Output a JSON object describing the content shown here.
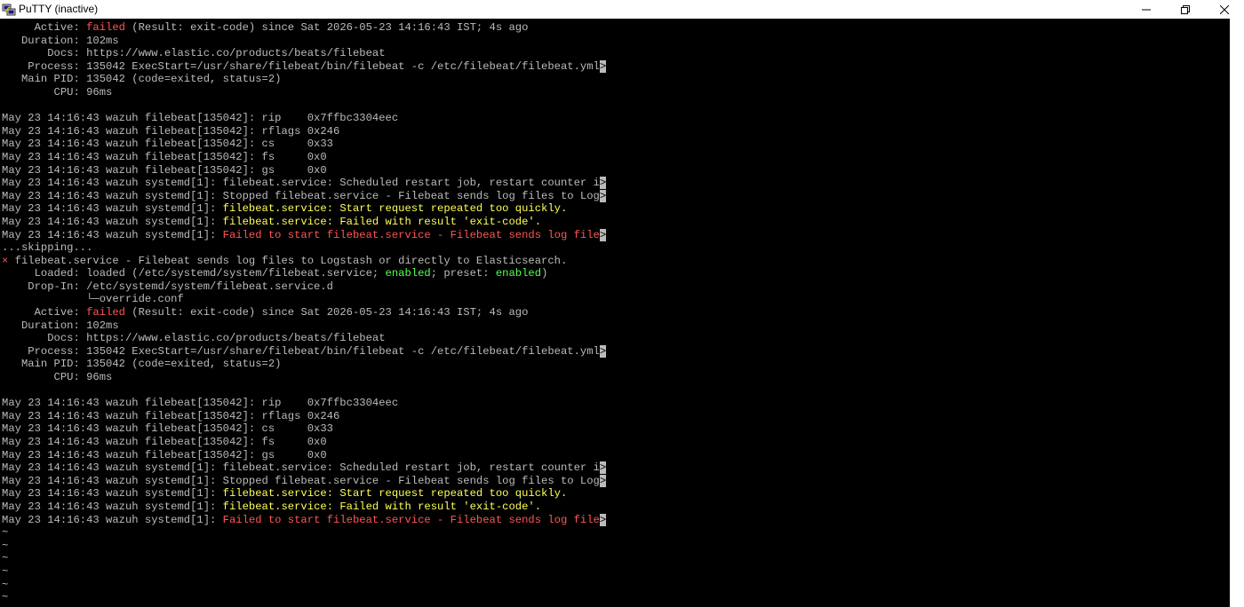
{
  "window": {
    "title": "PuTTY (inactive)",
    "icon": "putty-icon",
    "controls": [
      "minimize-icon",
      "restore-icon",
      "close-icon"
    ]
  },
  "terminal": {
    "lines": [
      {
        "segments": [
          {
            "t": "     Active: "
          },
          {
            "t": "failed",
            "c": "red"
          },
          {
            "t": " (Result: exit-code) since Sat 2026-05-23 14:16:43 IST; 4s ago"
          }
        ]
      },
      {
        "segments": [
          {
            "t": "   Duration: 102ms"
          }
        ]
      },
      {
        "segments": [
          {
            "t": "       Docs: https://www.elastic.co/products/beats/filebeat"
          }
        ]
      },
      {
        "segments": [
          {
            "t": "    Process: 135042 ExecStart=/usr/share/filebeat/bin/filebeat -c /etc/filebeat/filebeat.yml"
          },
          {
            "t": ">",
            "c": "trunc"
          }
        ]
      },
      {
        "segments": [
          {
            "t": "   Main PID: 135042 (code=exited, status=2)"
          }
        ]
      },
      {
        "segments": [
          {
            "t": "        CPU: 96ms"
          }
        ]
      },
      {
        "segments": [
          {
            "t": ""
          }
        ]
      },
      {
        "segments": [
          {
            "t": "May 23 14:16:43 wazuh filebeat[135042]: rip    0x7ffbc3304eec"
          }
        ]
      },
      {
        "segments": [
          {
            "t": "May 23 14:16:43 wazuh filebeat[135042]: rflags 0x246"
          }
        ]
      },
      {
        "segments": [
          {
            "t": "May 23 14:16:43 wazuh filebeat[135042]: cs     0x33"
          }
        ]
      },
      {
        "segments": [
          {
            "t": "May 23 14:16:43 wazuh filebeat[135042]: fs     0x0"
          }
        ]
      },
      {
        "segments": [
          {
            "t": "May 23 14:16:43 wazuh filebeat[135042]: gs     0x0"
          }
        ]
      },
      {
        "segments": [
          {
            "t": "May 23 14:16:43 wazuh systemd[1]: filebeat.service: Scheduled restart job, restart counter i"
          },
          {
            "t": ">",
            "c": "trunc"
          }
        ]
      },
      {
        "segments": [
          {
            "t": "May 23 14:16:43 wazuh systemd[1]: Stopped filebeat.service - Filebeat sends log files to Log"
          },
          {
            "t": ">",
            "c": "trunc"
          }
        ]
      },
      {
        "segments": [
          {
            "t": "May 23 14:16:43 wazuh systemd[1]: "
          },
          {
            "t": "filebeat.service: Start request repeated too quickly.",
            "c": "yellow"
          }
        ]
      },
      {
        "segments": [
          {
            "t": "May 23 14:16:43 wazuh systemd[1]: "
          },
          {
            "t": "filebeat.service: Failed with result 'exit-code'.",
            "c": "yellow"
          }
        ]
      },
      {
        "segments": [
          {
            "t": "May 23 14:16:43 wazuh systemd[1]: "
          },
          {
            "t": "Failed to start filebeat.service - Filebeat sends log file",
            "c": "red"
          },
          {
            "t": ">",
            "c": "trunc"
          }
        ]
      },
      {
        "segments": [
          {
            "t": "...skipping..."
          }
        ]
      },
      {
        "segments": [
          {
            "t": "×",
            "c": "red"
          },
          {
            "t": " filebeat.service - Filebeat sends log files to Logstash or directly to Elasticsearch."
          }
        ]
      },
      {
        "segments": [
          {
            "t": "     Loaded: loaded (/etc/systemd/system/filebeat.service; "
          },
          {
            "t": "enabled",
            "c": "green"
          },
          {
            "t": "; preset: "
          },
          {
            "t": "enabled",
            "c": "green"
          },
          {
            "t": ")"
          }
        ]
      },
      {
        "segments": [
          {
            "t": "    Drop-In: /etc/systemd/system/filebeat.service.d"
          }
        ]
      },
      {
        "segments": [
          {
            "t": "             └─override.conf"
          }
        ]
      },
      {
        "segments": [
          {
            "t": "     Active: "
          },
          {
            "t": "failed",
            "c": "red"
          },
          {
            "t": " (Result: exit-code) since Sat 2026-05-23 14:16:43 IST; 4s ago"
          }
        ]
      },
      {
        "segments": [
          {
            "t": "   Duration: 102ms"
          }
        ]
      },
      {
        "segments": [
          {
            "t": "       Docs: https://www.elastic.co/products/beats/filebeat"
          }
        ]
      },
      {
        "segments": [
          {
            "t": "    Process: 135042 ExecStart=/usr/share/filebeat/bin/filebeat -c /etc/filebeat/filebeat.yml"
          },
          {
            "t": ">",
            "c": "trunc"
          }
        ]
      },
      {
        "segments": [
          {
            "t": "   Main PID: 135042 (code=exited, status=2)"
          }
        ]
      },
      {
        "segments": [
          {
            "t": "        CPU: 96ms"
          }
        ]
      },
      {
        "segments": [
          {
            "t": ""
          }
        ]
      },
      {
        "segments": [
          {
            "t": "May 23 14:16:43 wazuh filebeat[135042]: rip    0x7ffbc3304eec"
          }
        ]
      },
      {
        "segments": [
          {
            "t": "May 23 14:16:43 wazuh filebeat[135042]: rflags 0x246"
          }
        ]
      },
      {
        "segments": [
          {
            "t": "May 23 14:16:43 wazuh filebeat[135042]: cs     0x33"
          }
        ]
      },
      {
        "segments": [
          {
            "t": "May 23 14:16:43 wazuh filebeat[135042]: fs     0x0"
          }
        ]
      },
      {
        "segments": [
          {
            "t": "May 23 14:16:43 wazuh filebeat[135042]: gs     0x0"
          }
        ]
      },
      {
        "segments": [
          {
            "t": "May 23 14:16:43 wazuh systemd[1]: filebeat.service: Scheduled restart job, restart counter i"
          },
          {
            "t": ">",
            "c": "trunc"
          }
        ]
      },
      {
        "segments": [
          {
            "t": "May 23 14:16:43 wazuh systemd[1]: Stopped filebeat.service - Filebeat sends log files to Log"
          },
          {
            "t": ">",
            "c": "trunc"
          }
        ]
      },
      {
        "segments": [
          {
            "t": "May 23 14:16:43 wazuh systemd[1]: "
          },
          {
            "t": "filebeat.service: Start request repeated too quickly.",
            "c": "yellow"
          }
        ]
      },
      {
        "segments": [
          {
            "t": "May 23 14:16:43 wazuh systemd[1]: "
          },
          {
            "t": "filebeat.service: Failed with result 'exit-code'.",
            "c": "yellow"
          }
        ]
      },
      {
        "segments": [
          {
            "t": "May 23 14:16:43 wazuh systemd[1]: "
          },
          {
            "t": "Failed to start filebeat.service - Filebeat sends log file",
            "c": "red"
          },
          {
            "t": ">",
            "c": "trunc"
          }
        ]
      },
      {
        "segments": [
          {
            "t": "~"
          }
        ]
      },
      {
        "segments": [
          {
            "t": "~"
          }
        ]
      },
      {
        "segments": [
          {
            "t": "~"
          }
        ]
      },
      {
        "segments": [
          {
            "t": "~"
          }
        ]
      },
      {
        "segments": [
          {
            "t": "~"
          }
        ]
      },
      {
        "segments": [
          {
            "t": "~"
          }
        ]
      }
    ]
  },
  "colors": {
    "background": "#000000",
    "foreground": "#bbbbbb",
    "red": "#ff5555",
    "yellow": "#ffff55",
    "green": "#55ff55"
  }
}
